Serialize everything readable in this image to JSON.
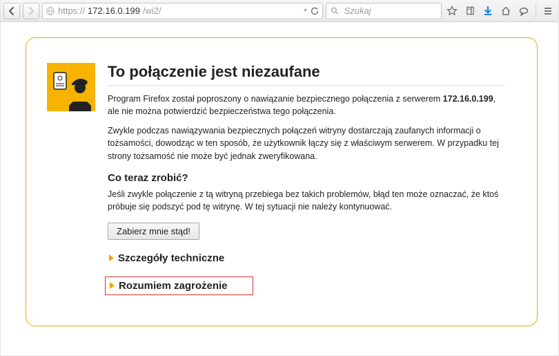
{
  "toolbar": {
    "url_proto": "https://",
    "url_host": "172.16.0.199",
    "url_path": "/wi2/",
    "search_placeholder": "Szukaj"
  },
  "page": {
    "title": "To połączenie jest niezaufane",
    "p1_a": "Program Firefox został poproszony o nawiązanie bezpiecznego połączenia z serwerem ",
    "p1_host": "172.16.0.199",
    "p1_b": ", ale nie można potwierdzić bezpieczeństwa tego połączenia.",
    "p2": "Zwykle podczas nawiązywania bezpiecznych połączeń witryny dostarczają zaufanych informacji o tożsamości, dowodząc w ten sposób, że użytkownik łączy się z właściwym serwerem. W przypadku tej strony tożsamość nie może być jednak zweryfikowana.",
    "sub1": "Co teraz zrobić?",
    "p3": "Jeśli zwykle połączenie z tą witryną przebiega bez takich problemów, błąd ten może oznaczać, że ktoś próbuje się podszyć pod tę witrynę. W tej sytuacji nie należy kontynuować.",
    "btn_getout": "Zabierz mnie stąd!",
    "exp_tech": "Szczegóły techniczne",
    "exp_risk": "Rozumiem zagrożenie"
  }
}
